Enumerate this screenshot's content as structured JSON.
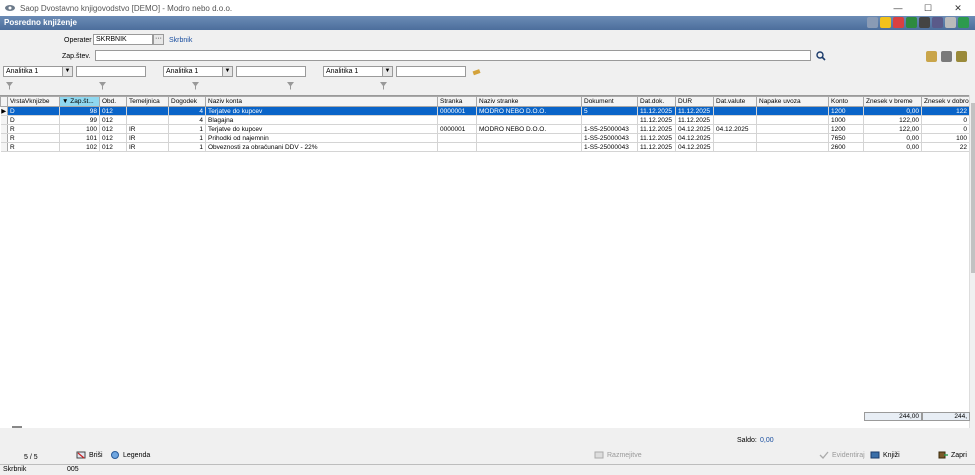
{
  "window": {
    "title": "Saop Dvostavno knjigovodstvo [DEMO] - Modro nebo d.o.o.",
    "minimize": "—",
    "maximize": "☐",
    "close": "✕"
  },
  "form": {
    "title": "Posredno knjiženje"
  },
  "toolbar_icons": [
    "window-icon",
    "star-icon",
    "pdf-icon",
    "excel-icon",
    "print-icon",
    "copy-icon",
    "copy-disabled-icon",
    "exit-icon"
  ],
  "filters": {
    "operater_label": "Operater",
    "operater_value": "SKRBNIK",
    "operater_dots": "···",
    "operater_name": "Skrbnik",
    "zapstev_label": "Zap.štev.",
    "zapstev_value": "",
    "analitika": [
      "Analitika 1",
      "Analitika 1",
      "Analitika 1"
    ],
    "analitika_values": [
      "",
      "",
      ""
    ]
  },
  "grid": {
    "columns": [
      "VrstaVknjizbe",
      "Zap.št...",
      "Obd.",
      "Temeljnica",
      "Dogodek",
      "Naziv konta",
      "Stranka",
      "Naziv stranke",
      "Dokument",
      "Dat.dok.",
      "DUR",
      "Dat.valute",
      "Napake uvoza",
      "Konto",
      "Znesek v breme",
      "Znesek v dobro"
    ],
    "rows": [
      [
        "D",
        "98",
        "012",
        "",
        "4",
        "Terjatve do kupcev",
        "0000001",
        "MODRO NEBO D.O.O.",
        "5",
        "11.12.2025",
        "11.12.2025",
        "",
        "",
        "1200",
        "0,00",
        "122"
      ],
      [
        "D",
        "99",
        "012",
        "",
        "4",
        "Blagajna",
        "",
        "",
        "",
        "11.12.2025",
        "11.12.2025",
        "",
        "",
        "1000",
        "122,00",
        "0"
      ],
      [
        "R",
        "100",
        "012",
        "IR",
        "1",
        "Terjatve do kupcev",
        "0000001",
        "MODRO NEBO D.O.O.",
        "1-S5-25000043",
        "11.12.2025",
        "04.12.2025",
        "04.12.2025",
        "",
        "1200",
        "122,00",
        "0"
      ],
      [
        "R",
        "101",
        "012",
        "IR",
        "1",
        "Prihodki od najemnin",
        "",
        "",
        "1-S5-25000043",
        "11.12.2025",
        "04.12.2025",
        "",
        "",
        "7650",
        "0,00",
        "100"
      ],
      [
        "R",
        "102",
        "012",
        "IR",
        "1",
        "Obveznosti za obračunani DDV - 22%",
        "",
        "",
        "1-S5-25000043",
        "11.12.2025",
        "04.12.2025",
        "",
        "",
        "2600",
        "0,00",
        "22"
      ]
    ],
    "selected_row": 0,
    "totals": {
      "breme": "244,00",
      "dobro": "244,"
    }
  },
  "footer": {
    "record_count": "5 / 5",
    "brisi": "Briši",
    "legenda": "Legenda",
    "razmejitve": "Razmejitve",
    "saldo_label": "Saldo:",
    "saldo_value": "0,00",
    "evidentiraj": "Evidentiraj",
    "knjizi": "Knjiži",
    "zapri": "Zapri"
  },
  "status": {
    "user": "Skrbnik",
    "code": "005"
  },
  "colors": {
    "selection": "#0a64c8",
    "formbar": "#4c6e9c",
    "link": "#1a4fa0",
    "sorted_header": "#8fd8f0"
  }
}
